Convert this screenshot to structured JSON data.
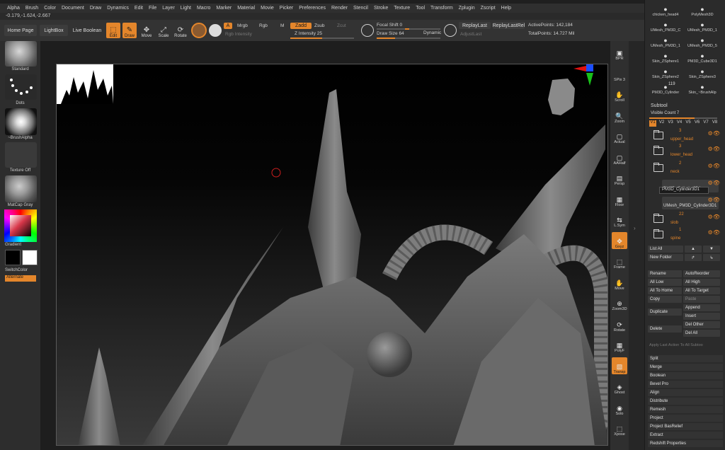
{
  "menu": [
    "Alpha",
    "Brush",
    "Color",
    "Document",
    "Draw",
    "Dynamics",
    "Edit",
    "File",
    "Layer",
    "Light",
    "Macro",
    "Marker",
    "Material",
    "Movie",
    "Picker",
    "Preferences",
    "Render",
    "Stencil",
    "Stroke",
    "Texture",
    "Tool",
    "Transform",
    "Zplugin",
    "Zscript",
    "Help"
  ],
  "coord": "-0.179,-1.624,-2.667",
  "toolbar": {
    "home_page": "Home Page",
    "lightbox": "LightBox",
    "live_boolean": "Live Boolean",
    "edit": "Edit",
    "draw": "Draw",
    "move": "Move",
    "scale": "Scale",
    "rotate": "Rotate",
    "a_label": "A",
    "mrgb": "Mrgb",
    "rgb": "Rgb",
    "m": "M",
    "rgb_intensity": "Rgb Intensity",
    "zadd": "Zadd",
    "zsub": "Zsub",
    "zcut": "Zcut",
    "z_intensity_label": "Z Intensity",
    "z_intensity_value": "25",
    "focal_shift_label": "Focal Shift",
    "focal_shift_value": "0",
    "draw_size_label": "Draw Size",
    "draw_size_value": "64",
    "dynamic": "Dynamic",
    "replay_last": "ReplayLast",
    "replay_last_rel": "ReplayLastRel",
    "adjust_last": "AdjustLast",
    "active_points_label": "ActivePoints:",
    "active_points_value": "142,184",
    "total_points_label": "TotalPoints:",
    "total_points_value": "14.727 Mil"
  },
  "left": {
    "standard": "Standard",
    "dots": "Dots",
    "brush_alpha": "~BrushAlpha",
    "texture_off": "Texture Off",
    "matcap": "MatCap Gray",
    "gradient": "Gradient",
    "switch_color": "SwitchColor",
    "alternate": "Alternate"
  },
  "right_shelf": [
    {
      "label": "BPR",
      "icon": "▣"
    },
    {
      "label": "SPix 3",
      "icon": ""
    },
    {
      "label": "Scroll",
      "icon": "✋"
    },
    {
      "label": "Zoom",
      "icon": "🔍"
    },
    {
      "label": "Actual",
      "icon": "▢"
    },
    {
      "label": "AAHalf",
      "icon": "▢"
    },
    {
      "label": "Persp",
      "icon": "▤"
    },
    {
      "label": "Floor",
      "icon": "▦"
    },
    {
      "label": "L.Sym",
      "icon": "⇆"
    },
    {
      "label": "Gxyz",
      "icon": "✥"
    },
    {
      "label": "Frame",
      "icon": "⬚"
    },
    {
      "label": "Move",
      "icon": "✋"
    },
    {
      "label": "Zoom3D",
      "icon": "⊕"
    },
    {
      "label": "Rotate",
      "icon": "⟳"
    },
    {
      "label": "PolyF",
      "icon": "▦"
    },
    {
      "label": "Transp",
      "icon": "▧"
    },
    {
      "label": "Ghost",
      "icon": "◈"
    },
    {
      "label": "Solo",
      "icon": "◉"
    },
    {
      "label": "Xpose",
      "icon": "⬚"
    }
  ],
  "tool_panel": {
    "tools": [
      "chicken_head4",
      "PolyMesh3D",
      "UMesh_PM3D_C",
      "UMesh_PM3D_1",
      "UMesh_PM3D_1",
      "UMesh_PM3D_5",
      "Skin_ZSphere1",
      "PM3D_Cube3D1",
      "Skin_ZSphere2",
      "Skin_ZSphere3",
      "PM3D_Cylinder",
      "Skin_~BrushAlp"
    ],
    "tool_count": "119",
    "subtool_title": "Subtool",
    "visible_count_label": "Visible Count",
    "visible_count_value": "7",
    "versions": [
      "V1",
      "V2",
      "V3",
      "V4",
      "V5",
      "V6",
      "V7",
      "V8"
    ],
    "subtools": [
      {
        "name": "upper_head",
        "count": "3"
      },
      {
        "name": "lower_head",
        "count": "3"
      },
      {
        "name": "neck",
        "count": "2"
      },
      {
        "name": "PM3D_Cylinder3D1",
        "count": ""
      },
      {
        "name": "UMesh_PM3D_Cylinder3D1",
        "count": ""
      },
      {
        "name": "slob",
        "count": "22"
      },
      {
        "name": "spine",
        "count": "1"
      }
    ],
    "tooltip": "PM3D_Cylinder3D1",
    "list_all": "List All",
    "new_folder": "New Folder",
    "rename": "Rename",
    "auto_reorder": "AutoReorder",
    "all_low": "All Low",
    "all_high": "All High",
    "all_to_home": "All To Home",
    "all_to_target": "All To Target",
    "copy": "Copy",
    "paste": "Paste",
    "append": "Append",
    "duplicate": "Duplicate",
    "insert": "Insert",
    "delete": "Delete",
    "del_other": "Del Other",
    "del_all": "Del All",
    "apply_last": "Apply Last Action To All Subtoo",
    "sections": [
      "Split",
      "Merge",
      "Boolean",
      "Bevel Pro",
      "Align",
      "Distribute",
      "Remesh",
      "Project",
      "Project BasRelief",
      "Extract",
      "Redshift Properties"
    ]
  },
  "colors": {
    "accent": "#e4862b",
    "panel": "#2b2b2b",
    "canvas": "#000000"
  }
}
